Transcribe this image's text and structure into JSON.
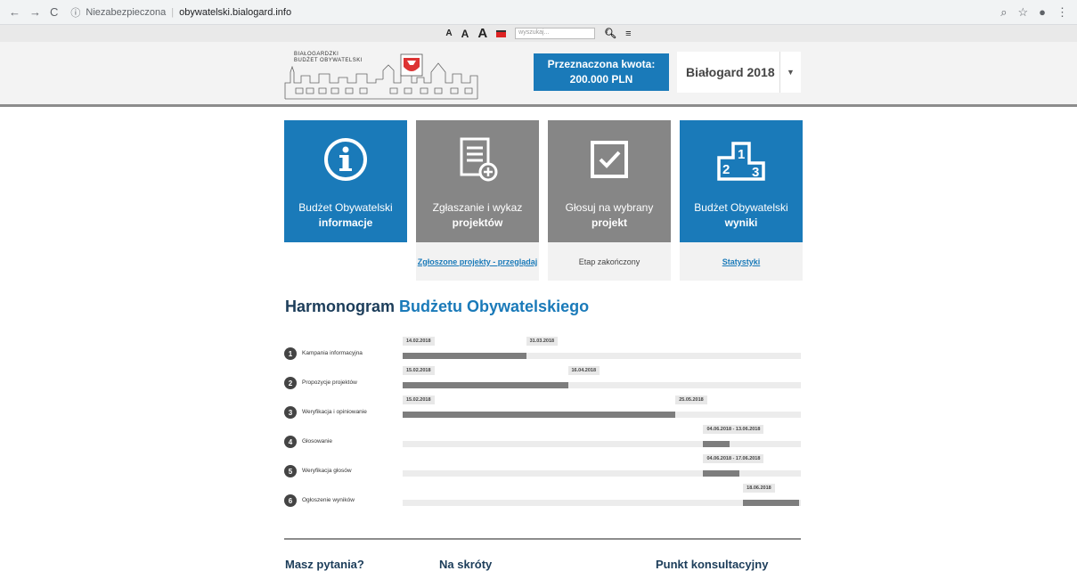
{
  "browser": {
    "back": "←",
    "forward": "→",
    "reload": "C",
    "insecure_label": "Niezabezpieczona",
    "url": "obywatelski.bialogard.info"
  },
  "toolbar": {
    "font_small": "A",
    "font_medium": "A",
    "font_large": "A",
    "search_placeholder": "wyszukaj..."
  },
  "header": {
    "logo_line1": "BIAŁOGARDZKI",
    "logo_line2": "BUDŻET OBYWATELSKI",
    "amount_line1": "Przeznaczona kwota:",
    "amount_line2": "200.000 PLN",
    "year_select": "Białogard 2018"
  },
  "tiles": [
    {
      "line1": "Budżet Obywatelski",
      "line2": "informacje",
      "icon": "info-icon",
      "color": "#1a7ab9",
      "under": ""
    },
    {
      "line1": "Zgłaszanie i wykaz",
      "line2": "projektów",
      "icon": "document-add-icon",
      "color": "#868686",
      "under": "Zgłoszone projekty - przeglądaj"
    },
    {
      "line1": "Głosuj na wybrany",
      "line2": "projekt",
      "icon": "checkbox-icon",
      "color": "#868686",
      "under": "Etap zakończony"
    },
    {
      "line1": "Budżet Obywatelski",
      "line2": "wyniki",
      "icon": "podium-icon",
      "color": "#1a7ab9",
      "under": "Statystyki"
    }
  ],
  "harmonogram": {
    "title_part1": "Harmonogram",
    "title_part2": "Budżetu Obywatelskiego",
    "rows": [
      {
        "num": "1",
        "name": "Kampania informacyjna",
        "tags": [
          "14.02.2018",
          "31.03.2018"
        ],
        "start": 0.0,
        "end": 0.31
      },
      {
        "num": "2",
        "name": "Propozycje projektów",
        "tags": [
          "15.02.2018",
          "16.04.2018"
        ],
        "start": 0.0,
        "end": 0.415
      },
      {
        "num": "3",
        "name": "Weryfikacja i opiniowanie",
        "tags": [
          "15.02.2018",
          "25.05.2018"
        ],
        "start": 0.0,
        "end": 0.685
      },
      {
        "num": "4",
        "name": "Głosowanie",
        "tags": [
          "04.06.2018 - 13.06.2018"
        ],
        "start": 0.755,
        "end": 0.82
      },
      {
        "num": "5",
        "name": "Weryfikacja głosów",
        "tags": [
          "04.06.2018 - 17.06.2018"
        ],
        "start": 0.755,
        "end": 0.845
      },
      {
        "num": "6",
        "name": "Ogłoszenie wyników",
        "tags": [
          "18.06.2018"
        ],
        "start": 0.855,
        "end": 0.995
      }
    ]
  },
  "footer": {
    "col1": "Masz pytania?",
    "col2": "Na skróty",
    "col3": "Punkt konsultacyjny"
  }
}
